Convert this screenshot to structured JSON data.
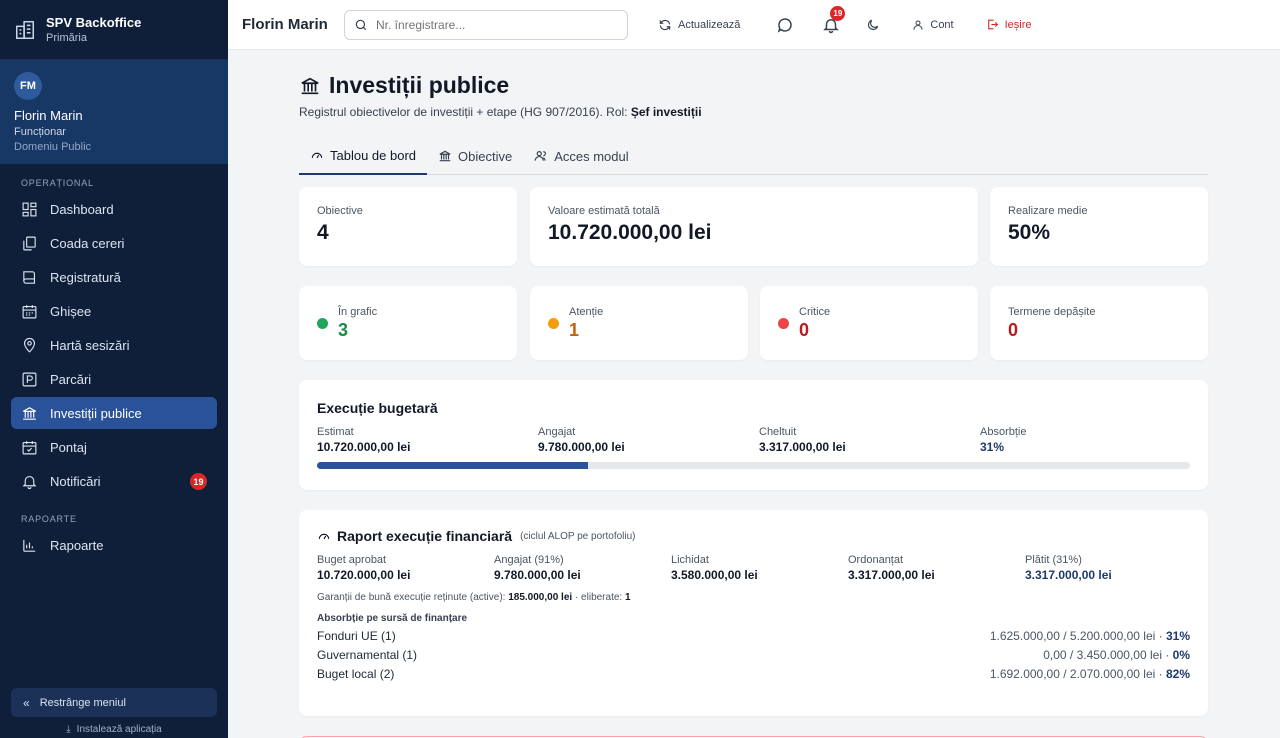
{
  "sidebar": {
    "brand_title": "SPV Backoffice",
    "brand_sub": "Primăria",
    "user": {
      "initials": "FM",
      "name": "Florin Marin",
      "role": "Funcționar",
      "dept": "Domeniu Public"
    },
    "section_operational": "OPERAȚIONAL",
    "items": [
      {
        "label": "Dashboard",
        "icon": "grid-icon"
      },
      {
        "label": "Coada cereri",
        "icon": "copy-icon"
      },
      {
        "label": "Registratură",
        "icon": "book-icon"
      },
      {
        "label": "Ghișee",
        "icon": "calendar-icon"
      },
      {
        "label": "Hartă sesizări",
        "icon": "map-pin-icon"
      },
      {
        "label": "Parcări",
        "icon": "parking-icon"
      },
      {
        "label": "Investiții publice",
        "icon": "bank-icon"
      },
      {
        "label": "Pontaj",
        "icon": "calendar-check-icon"
      },
      {
        "label": "Notificări",
        "icon": "bell-icon",
        "badge": "19"
      }
    ],
    "section_reports": "RAPOARTE",
    "reports_item": "Rapoarte",
    "collapse_label": "Restrânge meniul",
    "install_label": "Instalează aplicația"
  },
  "topbar": {
    "user_name": "Florin Marin",
    "search_placeholder": "Nr. înregistrare...",
    "refresh_label": "Actualizează",
    "notif_count": "19",
    "account_label": "Cont",
    "logout_label": "Ieșire"
  },
  "page": {
    "title": "Investiții publice",
    "subtitle": "Registrul obiectivelor de investiții + etape (HG 907/2016). Rol: ",
    "role": "Șef investiții",
    "tabs": [
      "Tablou de bord",
      "Obiective",
      "Acces modul"
    ]
  },
  "kpis": {
    "objectives_label": "Obiective",
    "objectives_value": "4",
    "total_label": "Valoare estimată totală",
    "total_value": "10.720.000,00 lei",
    "realization_label": "Realizare medie",
    "realization_value": "50%"
  },
  "stats": [
    {
      "label": "În grafic",
      "value": "3",
      "color": "#22a55a"
    },
    {
      "label": "Atenție",
      "value": "1",
      "color": "#f59e0b"
    },
    {
      "label": "Critice",
      "value": "0",
      "color": "#ef4444"
    },
    {
      "label": "Termene depășite",
      "value": "0",
      "color": "#b91c1c"
    }
  ],
  "budget": {
    "title": "Execuție bugetară",
    "cols": [
      {
        "label": "Estimat",
        "value": "10.720.000,00 lei"
      },
      {
        "label": "Angajat",
        "value": "9.780.000,00 lei"
      },
      {
        "label": "Cheltuit",
        "value": "3.317.000,00 lei"
      },
      {
        "label": "Absorbție",
        "value": "31%"
      }
    ],
    "absorption_fraction": 0.31
  },
  "report": {
    "title": "Raport execuție financiară",
    "note": "(ciclul ALOP pe portofoliu)",
    "cols": [
      {
        "label": "Buget aprobat",
        "value": "10.720.000,00 lei"
      },
      {
        "label": "Angajat (91%)",
        "value": "9.780.000,00 lei"
      },
      {
        "label": "Lichidat",
        "value": "3.580.000,00 lei"
      },
      {
        "label": "Ordonanțat",
        "value": "3.317.000,00 lei"
      },
      {
        "label": "Plătit (31%)",
        "value": "3.317.000,00 lei"
      }
    ],
    "guarantee_text": "Garanții de bună execuție reținute (active): ",
    "guarantee_value": "185.000,00 lei",
    "released_text": " · eliberate: ",
    "released_value": "1",
    "sources_title": "Absorbție pe sursă de finanțare",
    "sources": [
      {
        "name": "Fonduri UE (1)",
        "amounts": "1.625.000,00 / 5.200.000,00 lei · ",
        "pct": "31%"
      },
      {
        "name": "Guvernamental (1)",
        "amounts": "0,00 / 3.450.000,00 lei · ",
        "pct": "0%"
      },
      {
        "name": "Buget local (2)",
        "amounts": "1.692.000,00 / 2.070.000,00 lei · ",
        "pct": "82%"
      }
    ]
  }
}
